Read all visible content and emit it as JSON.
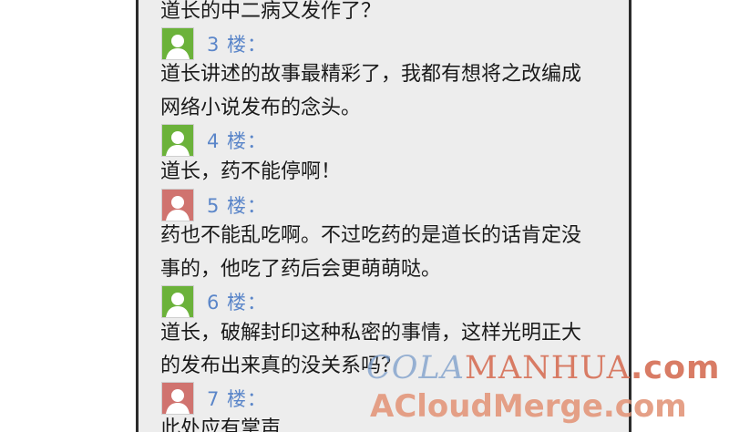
{
  "comments": [
    {
      "text_lines": [
        "道长的中二病又发作了？"
      ]
    },
    {
      "floor": "3 楼：",
      "avatar_color": "#6bb23a",
      "text_lines": [
        "道长讲述的故事最精彩了，我都有想将之改编成",
        "网络小说发布的念头。"
      ]
    },
    {
      "floor": "4 楼：",
      "avatar_color": "#6bb23a",
      "text_lines": [
        "道长，药不能停啊！"
      ]
    },
    {
      "floor": "5 楼：",
      "avatar_color": "#d0736f",
      "text_lines": [
        "药也不能乱吃啊。不过吃药的是道长的话肯定没",
        "事的，他吃了药后会更萌萌哒。"
      ]
    },
    {
      "floor": "6 楼：",
      "avatar_color": "#6bb23a",
      "text_lines": [
        "道长，破解封印这种私密的事情，这样光明正大",
        "的发布出来真的没关系吗？"
      ]
    },
    {
      "floor": "7 楼：",
      "avatar_color": "#d0736f",
      "text_lines": [
        "此处应有掌声"
      ]
    }
  ],
  "watermark": {
    "line1_part_a": "COLA",
    "line1_part_b": "MANHUA",
    "line1_part_c": ".com",
    "line2": "ACloudMerge.com"
  },
  "icons": {
    "avatar": "user-avatar-icon"
  }
}
